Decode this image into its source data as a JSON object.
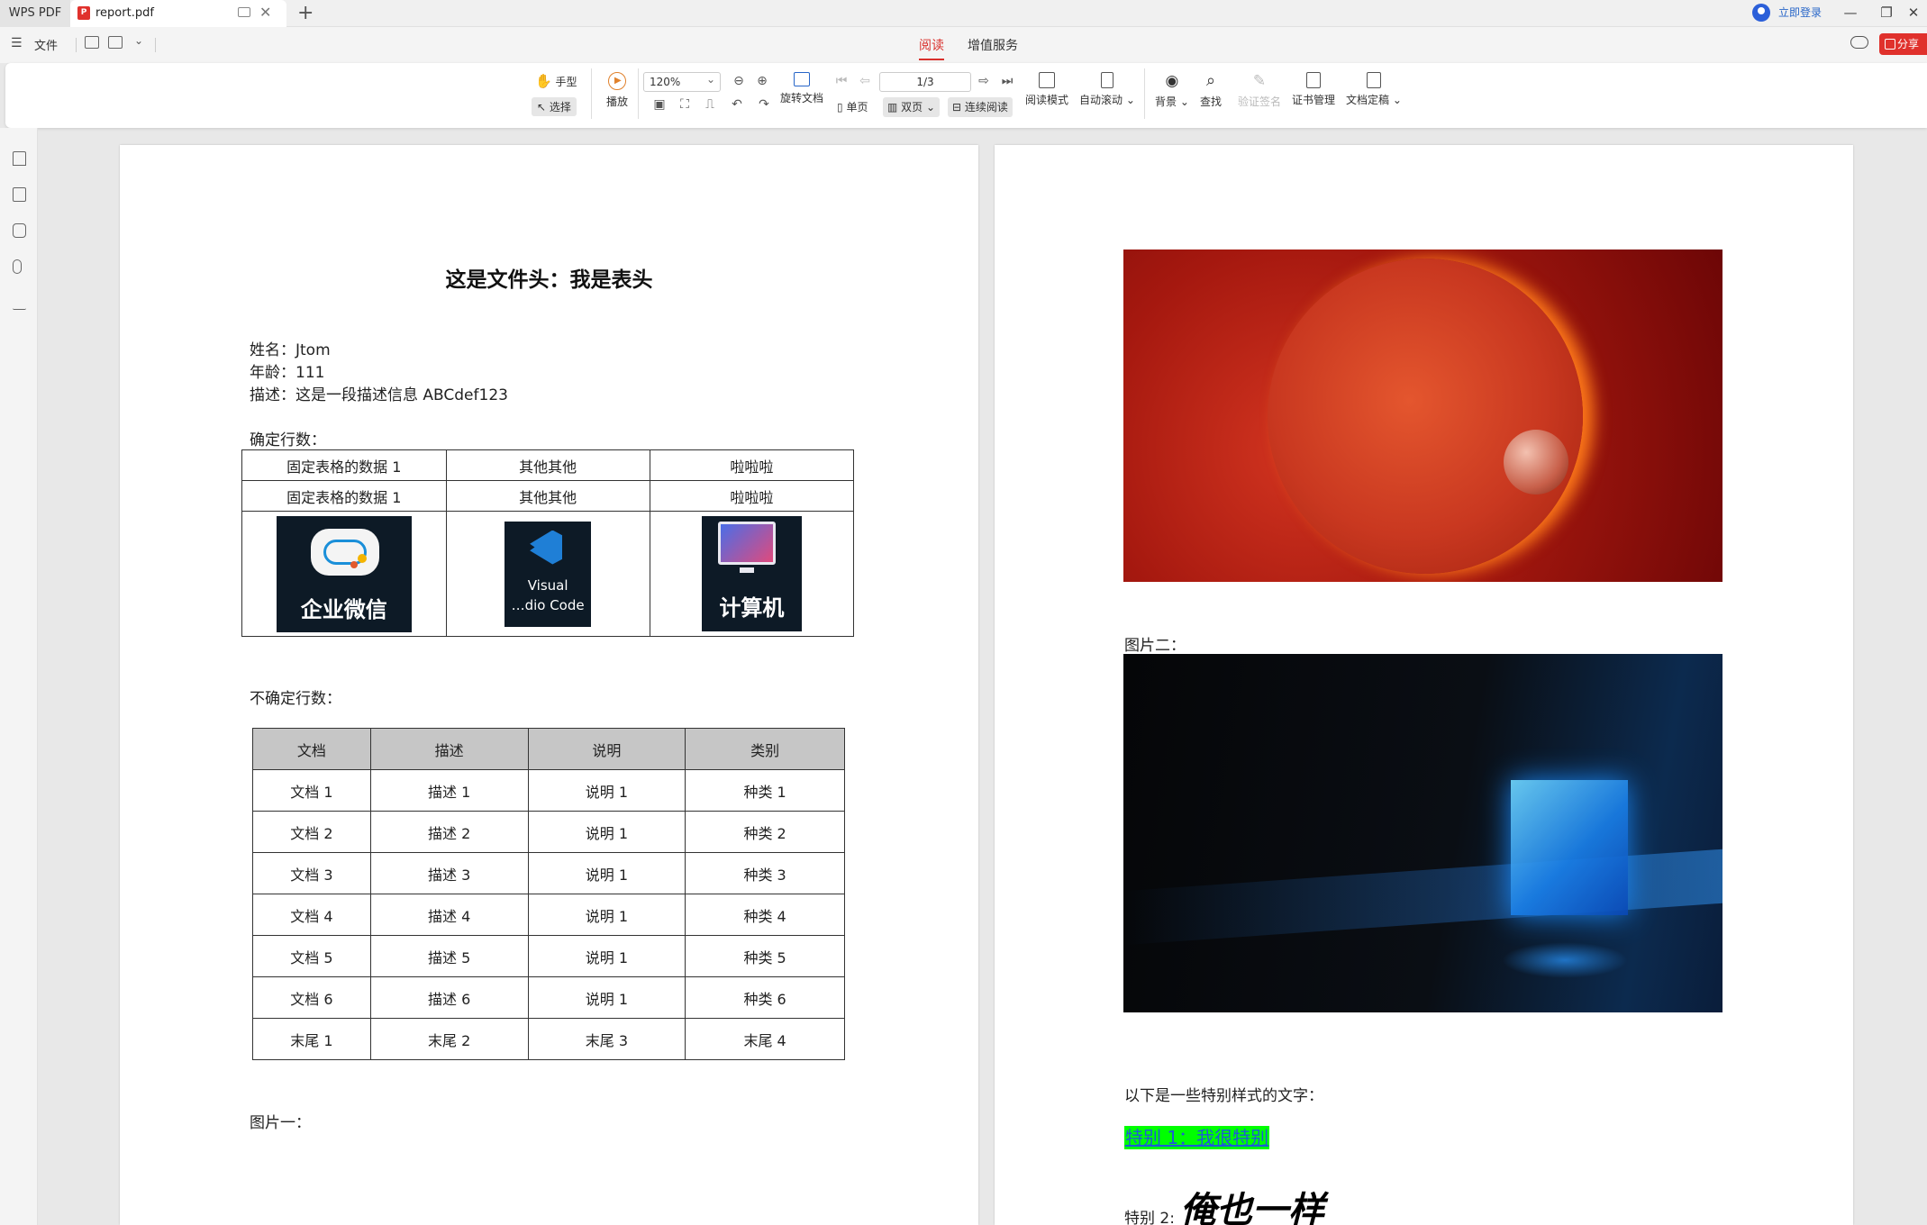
{
  "titlebar": {
    "app_label": "WPS PDF",
    "tab_title": "report.pdf",
    "tab_pdf_badge": "P",
    "login_label": "立即登录",
    "window_buttons": [
      "—",
      "❐",
      "✕"
    ]
  },
  "menubar": {
    "menu_glyph": "☰",
    "file_label": "文件",
    "tabs": [
      {
        "label": "阅读",
        "active": true
      },
      {
        "label": "增值服务",
        "active": false
      }
    ],
    "share_label": "分享"
  },
  "toolbar": {
    "hand_label": "手型",
    "select_label": "选择",
    "play_label": "播放",
    "zoom_value": "120%",
    "rotate_label": "旋转文档",
    "page_value": "1/3",
    "single_label": "单页",
    "double_label": "双页",
    "continuous_label": "连续阅读",
    "read_mode_label": "阅读模式",
    "auto_scroll_label": "自动滚动",
    "background_label": "背景",
    "find_label": "查找",
    "verify_sign_label": "验证签名",
    "cert_label": "证书管理",
    "finalize_label": "文档定稿"
  },
  "page1": {
    "title": "这是文件头：我是表头",
    "info": [
      "姓名：Jtom",
      "年龄：111",
      "描述：这是一段描述信息 ABCdef123"
    ],
    "fixed_label": "确定行数：",
    "fixed_rows": [
      [
        "固定表格的数据 1",
        "其他其他",
        "啦啦啦"
      ],
      [
        "固定表格的数据 1",
        "其他其他",
        "啦啦啦"
      ]
    ],
    "logos": [
      "企业微信",
      "Visual",
      "…dio Code",
      "计算机"
    ],
    "var_label": "不确定行数：",
    "var_headers": [
      "文档",
      "描述",
      "说明",
      "类别"
    ],
    "var_rows": [
      [
        "文档 1",
        "描述 1",
        "说明 1",
        "种类 1"
      ],
      [
        "文档 2",
        "描述 2",
        "说明 1",
        "种类 2"
      ],
      [
        "文档 3",
        "描述 3",
        "说明 1",
        "种类 3"
      ],
      [
        "文档 4",
        "描述 4",
        "说明 1",
        "种类 4"
      ],
      [
        "文档 5",
        "描述 5",
        "说明 1",
        "种类 5"
      ],
      [
        "文档 6",
        "描述 6",
        "说明 1",
        "种类 6"
      ],
      [
        "末尾 1",
        "末尾 2",
        "末尾 3",
        "末尾 4"
      ]
    ],
    "image1_label": "图片一："
  },
  "page2": {
    "image2_label": "图片二：",
    "special_intro": "以下是一些特别样式的文字：",
    "special1": "特别 1：我很特别",
    "special2_label": "特别 2:",
    "special2": "俺也一样"
  },
  "colors": {
    "accent": "#e0312c",
    "link": "#2866c8",
    "highlight": "#00ff00"
  }
}
